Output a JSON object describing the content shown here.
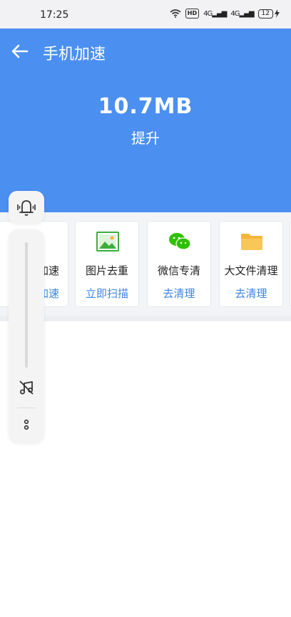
{
  "status_bar": {
    "time": "17:25",
    "hd_badge": "HD",
    "signal1": "4G",
    "signal2": "4G",
    "battery": "12"
  },
  "header": {
    "title": "手机加速",
    "back_icon": "back-arrow-icon"
  },
  "summary": {
    "value": "10.7MB",
    "label": "提升"
  },
  "cards": [
    {
      "label": "加速",
      "action": "加速",
      "icon": "speed-icon"
    },
    {
      "label": "图片去重",
      "action": "立即扫描",
      "icon": "image-icon"
    },
    {
      "label": "微信专清",
      "action": "去清理",
      "icon": "wechat-icon"
    },
    {
      "label": "大文件清理",
      "action": "去清理",
      "icon": "folder-icon"
    }
  ],
  "colors": {
    "primary": "#4b8ff1",
    "action": "#3a86e2",
    "wechat": "#2dc100",
    "folder": "#f5b63a",
    "image": "#3cae3c"
  },
  "volume_overlay": {
    "icons": [
      "bell-vibrate-icon",
      "music-off-icon",
      "more-dots-icon"
    ]
  }
}
